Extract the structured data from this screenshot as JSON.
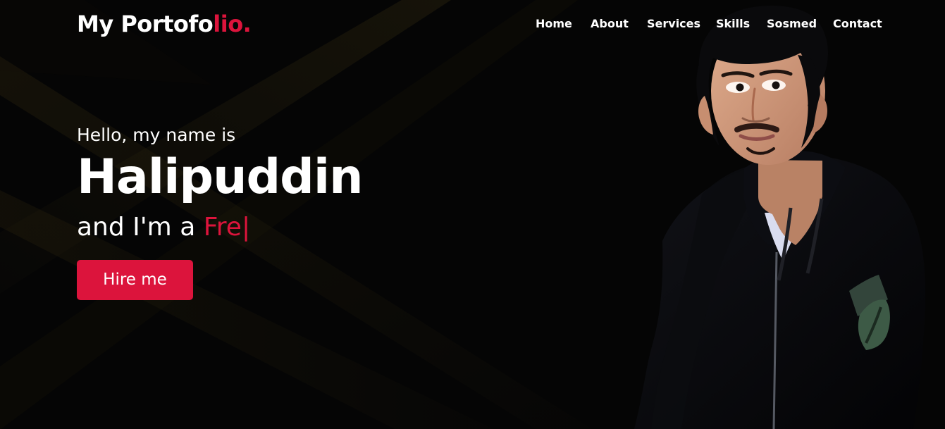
{
  "brand": {
    "prefix": "My Portofo",
    "accent": "lio."
  },
  "nav": {
    "items": [
      {
        "label": "Home"
      },
      {
        "label": "About"
      },
      {
        "label": "Services"
      },
      {
        "label": "Skills"
      },
      {
        "label": "Sosmed"
      },
      {
        "label": "Contact"
      }
    ]
  },
  "hero": {
    "greeting": "Hello, my name is",
    "name": "Halipuddin",
    "role_prefix": "and I'm a ",
    "typed_text": "Fre",
    "cursor": "|",
    "button_label": "Hire me"
  },
  "colors": {
    "background": "#050505",
    "accent": "#dc143c",
    "text": "#ffffff",
    "ray": "#2a220d"
  },
  "icons": {
    "portrait": "profile-photo"
  }
}
